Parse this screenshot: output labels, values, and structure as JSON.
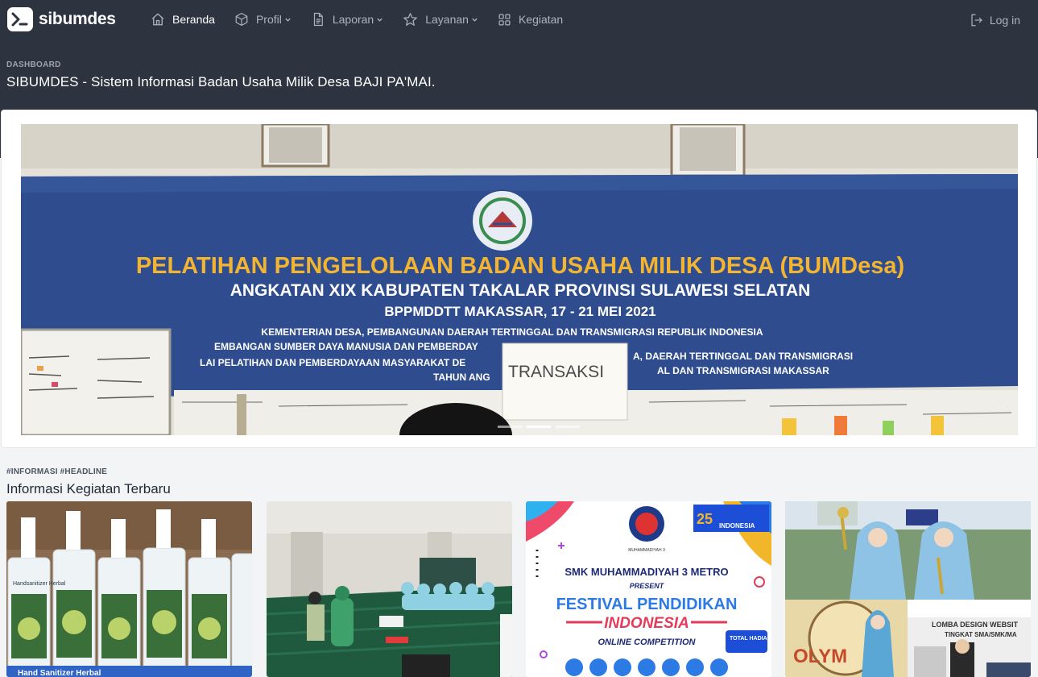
{
  "app": {
    "logo_text": "sibumdes"
  },
  "nav": {
    "items": [
      {
        "label": "Beranda",
        "icon": "home-icon",
        "active": true
      },
      {
        "label": "Profil",
        "icon": "cube-icon",
        "dropdown": true
      },
      {
        "label": "Laporan",
        "icon": "document-icon",
        "dropdown": true
      },
      {
        "label": "Layanan",
        "icon": "star-icon",
        "dropdown": true
      },
      {
        "label": "Kegiatan",
        "icon": "grid-icon"
      }
    ],
    "login_label": "Log in"
  },
  "header": {
    "eyebrow": "DASHBOARD",
    "title": "SIBUMDES - Sistem Informasi Badan Usaha Milik Desa BAJI PA'MAI."
  },
  "carousel": {
    "banner_line1": "PELATIHAN PENGELOLAAN BADAN USAHA MILIK DESA (BUMDesa)",
    "banner_line2": "ANGKATAN XIX KABUPATEN TAKALAR PROVINSI SULAWESI SELATAN",
    "banner_line3": "BPPMDDTT MAKASSAR, 17 - 21 MEI 2021",
    "banner_line4": "KEMENTERIAN DESA, PEMBANGUNAN DAERAH TERTINGGAL DAN TRANSMIGRASI REPUBLIK INDONESIA",
    "banner_line5": "EMBANGAN SUMBER DAYA MANUSIA DAN PEMBERDAY",
    "banner_line5b": "A, DAERAH TERTINGGAL DAN TRANSMIGRASI",
    "banner_line6": "LAI PELATIHAN DAN PEMBERDAYAAN MASYARAKAT DE",
    "banner_line6b": "AL DAN TRANSMIGRASI MAKASSAR",
    "banner_line7": "TAHUN ANG",
    "paper_text": "TRANSAKSI",
    "indicator_count": 3,
    "active_index": 1
  },
  "section": {
    "eyebrow": "#INFORMASI #HEADLINE",
    "title": "Informasi Kegiatan Terbaru"
  },
  "cards": [
    {
      "caption": "Hand Sanitizer Herbal",
      "label": "Handsanitizer Herbal"
    },
    {
      "caption": ""
    },
    {
      "school": "SMK MUHAMMADIYAH 3 METRO",
      "present": "PRESENT",
      "festival": "FESTIVAL PENDIDIKAN",
      "country": "INDONESIA",
      "competition": "ONLINE COMPETITION",
      "badge": "25",
      "tag": "INDONESIA",
      "hadiah": "TOTAL HADIAH"
    },
    {
      "lomba": "LOMBA DESIGN WEBSIT",
      "tingkat": "TINGKAT SMA/SMK/MA"
    }
  ]
}
